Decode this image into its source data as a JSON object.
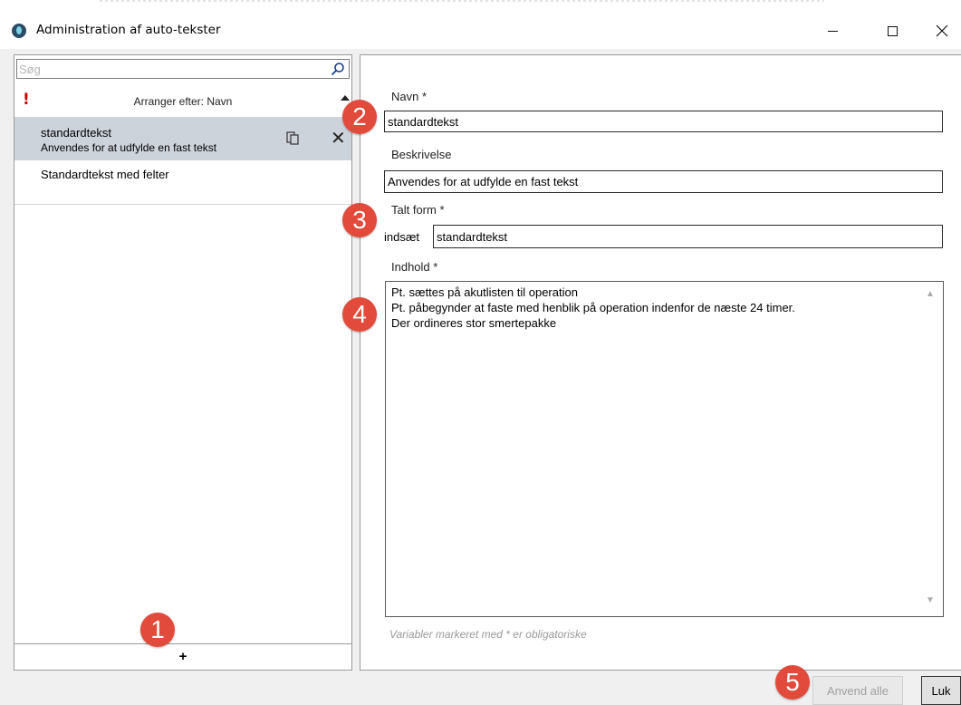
{
  "window": {
    "title": "Administration af auto-tekster",
    "minimize_icon": "minimize-icon",
    "maximize_icon": "maximize-icon",
    "close_icon": "close-icon"
  },
  "left_panel": {
    "search_placeholder": "Søg",
    "search_icon": "search-icon",
    "sort_label": "Arranger efter: Navn",
    "warning_icon": "!",
    "items": [
      {
        "name": "standardtekst",
        "description": "Anvendes for at udfylde en fast tekst"
      },
      {
        "name": "Standardtekst med felter"
      }
    ],
    "add_label": "+"
  },
  "form": {
    "name_label": "Navn *",
    "name_value": "standardtekst",
    "description_label": "Beskrivelse",
    "description_value": "Anvendes for at udfylde en fast tekst",
    "spoken_label": "Talt form *",
    "spoken_prefix": "indsæt",
    "spoken_value": "standardtekst",
    "content_label": "Indhold *",
    "content_value": "Pt. sættes på akutlisten til operation\nPt. påbegynder at faste med henblik på operation indenfor de næste 24 timer.\nDer ordineres stor smertepakke",
    "hint": "Variabler markeret med * er obligatoriske"
  },
  "buttons": {
    "apply_all": "Anvend alle",
    "close": "Luk"
  },
  "markers": [
    "1",
    "2",
    "3",
    "4",
    "5"
  ],
  "colors": {
    "marker": "#e24a3b",
    "selected_row": "#cdd3db",
    "warning": "#d00000"
  }
}
